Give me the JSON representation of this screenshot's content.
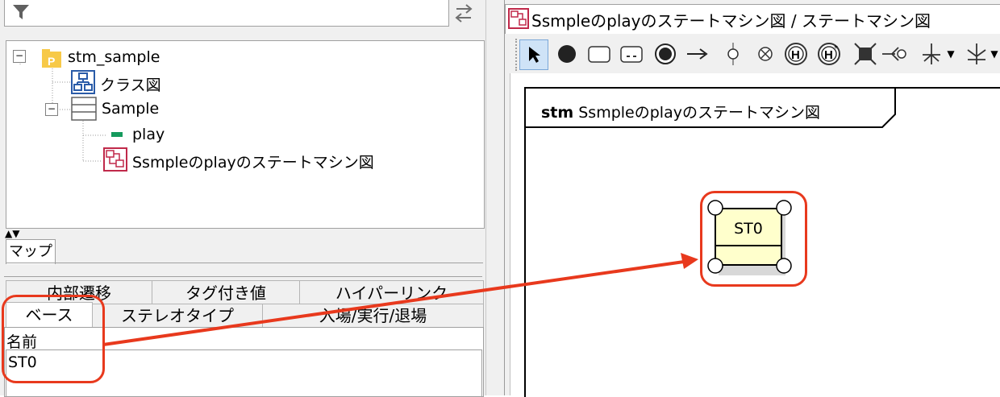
{
  "tree": {
    "root": "stm_sample",
    "items": [
      "クラス図",
      "Sample",
      "play",
      "Ssmpleのplayのステートマシン図"
    ]
  },
  "map_tab": "マップ",
  "props": {
    "tabs_row1": [
      "内部遷移",
      "タグ付き値",
      "ハイパーリンク"
    ],
    "tabs_row2": [
      "ベース",
      "ステレオタイプ",
      "入場/実行/退場"
    ],
    "name_label": "名前",
    "name_value": "ST0"
  },
  "diagram": {
    "tab_title": "Ssmpleのplayのステートマシン図 / ステートマシン図",
    "frame_keyword": "stm",
    "frame_name": "Ssmpleのplayのステートマシン図",
    "state_name": "ST0"
  },
  "colors": {
    "highlight": "#e8391d",
    "state_fill": "#ffffcc",
    "package_icon": "#f7c948"
  }
}
